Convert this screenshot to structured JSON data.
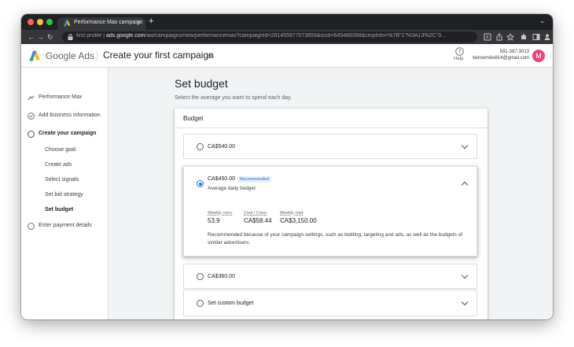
{
  "browser": {
    "tab_title": "Performance Max campaign",
    "tab_close": "×",
    "new_tab": "+",
    "url_prefix": "first profile",
    "url_domain": "ads.google.com",
    "url_path": "/aw/campaigns/new/performancemax?campaignId=281455977073659&ocid=645489398&cmpInfo=%7B\"1\"%3A13%2C\"3..."
  },
  "header": {
    "brand": "Google Ads",
    "title": "Create your first campaign",
    "help_label": "Help",
    "account_id": "591-387-3013",
    "account_email": "belowmike814@gmail.com",
    "avatar_letter": "M",
    "avatar_color": "#e8467c"
  },
  "sidebar": {
    "items": [
      {
        "label": "Performance Max",
        "icon": "performance-max-icon"
      },
      {
        "label": "Add business information",
        "icon": "check-circle-icon"
      },
      {
        "label": "Create your campaign",
        "icon": "radio-circle-icon"
      },
      {
        "label": "Enter payment details",
        "icon": "radio-circle-icon"
      }
    ],
    "subitems": [
      {
        "label": "Choose goal"
      },
      {
        "label": "Create ads"
      },
      {
        "label": "Select signals"
      },
      {
        "label": "Set bid strategy"
      },
      {
        "label": "Set budget",
        "active": true
      }
    ]
  },
  "main": {
    "title": "Set budget",
    "subtitle": "Select the average you want to spend each day.",
    "card_heading": "Budget",
    "options": [
      {
        "label": "CA$540.00",
        "selected": false
      },
      {
        "label": "CA$450.00",
        "selected": true,
        "badge": "Recommended",
        "sublabel": "Average daily budget",
        "metrics": [
          {
            "label": "Weekly conv.",
            "value": "53.9"
          },
          {
            "label": "Cost / Conv.",
            "value": "CA$58.44"
          },
          {
            "label": "Weekly cost",
            "value": "CA$3,150.00"
          }
        ],
        "recommendation": "Recommended because of your campaign settings, such as bidding, targeting and ads, as well as the budgets of similar advertisers."
      },
      {
        "label": "CA$360.00",
        "selected": false
      },
      {
        "label": "Set custom budget",
        "selected": false
      }
    ]
  },
  "colors": {
    "accent_blue": "#1a73e8",
    "chrome_dark": "#202124"
  }
}
